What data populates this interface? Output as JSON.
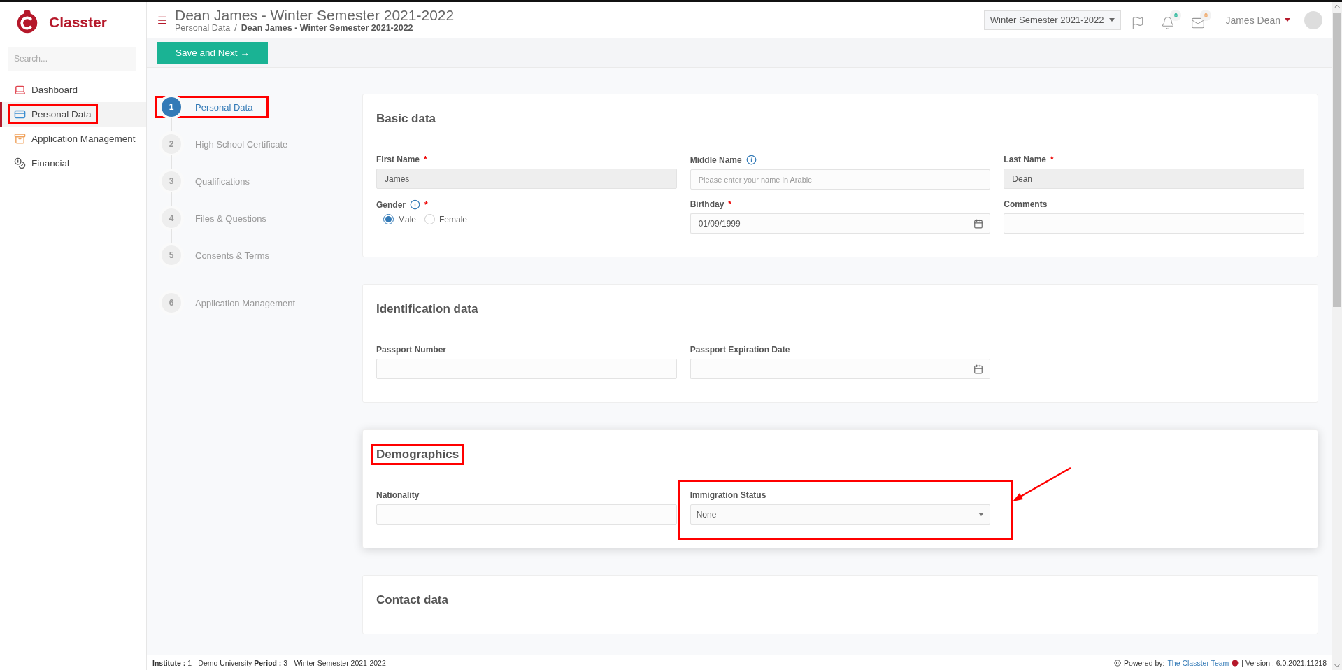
{
  "brand": {
    "name": "Classter"
  },
  "sidebar": {
    "search_placeholder": "Search...",
    "items": [
      {
        "label": "Dashboard",
        "selected": false,
        "highlighted": false
      },
      {
        "label": "Personal Data",
        "selected": true,
        "highlighted": true
      },
      {
        "label": "Application Management",
        "selected": false,
        "highlighted": false
      },
      {
        "label": "Financial",
        "selected": false,
        "highlighted": false
      }
    ]
  },
  "header": {
    "title": "Dean James - Winter Semester 2021-2022",
    "breadcrumb": [
      "Personal Data",
      "Dean James - Winter Semester 2021-2022"
    ],
    "breadcrumb_separator": "/",
    "period_select": "Winter Semester 2021-2022",
    "notifications": "0",
    "messages": "0",
    "user": "James Dean"
  },
  "toolbar": {
    "save_button": "Save and Next →"
  },
  "steps": [
    {
      "number": "1",
      "label": "Personal Data",
      "selected": true,
      "highlighted": true,
      "connector": true
    },
    {
      "number": "2",
      "label": "High School Certificate",
      "selected": false,
      "connector": true
    },
    {
      "number": "3",
      "label": "Qualifications",
      "selected": false,
      "connector": true
    },
    {
      "number": "4",
      "label": "Files & Questions",
      "selected": false,
      "connector": true
    },
    {
      "number": "5",
      "label": "Consents & Terms",
      "selected": false,
      "connector": false
    },
    {
      "number": "6",
      "label": "Application Management",
      "selected": false
    }
  ],
  "sections": [
    {
      "title": "Basic data",
      "highlighted": false,
      "raised": false,
      "fields": [
        {
          "label": "First Name",
          "kind": "text",
          "required_mark": "*",
          "value": "James",
          "disabled": true
        },
        {
          "label": "Middle Name",
          "kind": "text",
          "info": true,
          "placeholder": "Please enter your name in Arabic",
          "disabled": false
        },
        {
          "label": "Last Name",
          "kind": "text",
          "required_mark": "*",
          "value": "Dean",
          "disabled": true
        },
        {
          "label": "Gender",
          "kind": "radio",
          "required_mark": "*",
          "info": true,
          "options": [
            {
              "label": "Male",
              "selected": true
            },
            {
              "label": "Female",
              "selected": false
            }
          ]
        },
        {
          "label": "Birthday",
          "kind": "date",
          "required_mark": "*",
          "value": "01/09/1999"
        },
        {
          "label": "Comments",
          "kind": "text",
          "disabled": false
        }
      ]
    },
    {
      "title": "Identification data",
      "highlighted": false,
      "raised": false,
      "fields": [
        {
          "label": "Passport Number",
          "kind": "text",
          "disabled": false
        },
        {
          "label": "Passport Expiration Date",
          "kind": "date"
        }
      ]
    },
    {
      "title": "Demographics",
      "highlighted": true,
      "raised": true,
      "fields": [
        {
          "label": "Nationality",
          "kind": "text",
          "disabled": false
        },
        {
          "label": "Immigration Status",
          "kind": "select",
          "value": "None",
          "highlighted": true
        }
      ]
    },
    {
      "title": "Contact data",
      "highlighted": false,
      "raised": false
    }
  ],
  "footer": {
    "info": "**Institute :** 1 - Demo University **Period :** 3 - Winter Semester 2021-2022",
    "powered": "Powered by:",
    "team_link": "The Classter Team",
    "version": "| Version : 6.0.2021.11218"
  }
}
